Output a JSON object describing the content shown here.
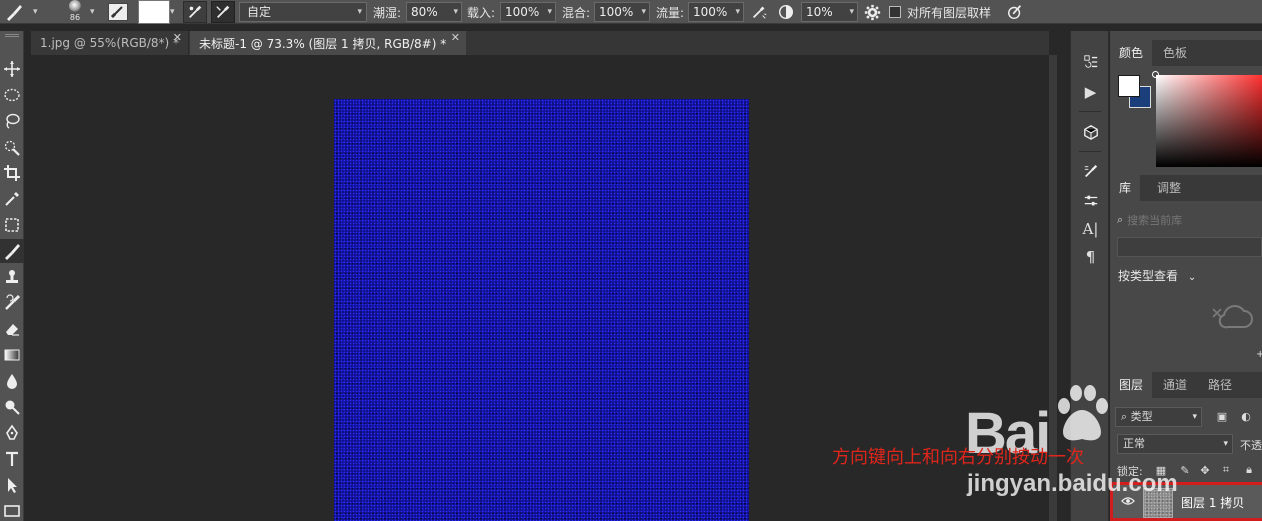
{
  "options_bar": {
    "brush_size": "86",
    "mode_label": "自定",
    "opacity_label": "潮湿:",
    "opacity_value": "80%",
    "load_label": "载入:",
    "load_value": "100%",
    "mix_label": "混合:",
    "mix_value": "100%",
    "flow_label": "流量:",
    "flow_value": "100%",
    "angle_value": "10%",
    "sample_all_label": "对所有图层取样"
  },
  "doc_tabs": [
    {
      "title": "1.jpg @ 55%(RGB/8*) *",
      "active": false
    },
    {
      "title": "未标题-1 @ 73.3% (图层 1 拷贝, RGB/8#) *",
      "active": true
    }
  ],
  "tools": [
    {
      "icon": "move-icon"
    },
    {
      "icon": "marquee-icon"
    },
    {
      "icon": "lasso-icon"
    },
    {
      "icon": "quick-select-icon"
    },
    {
      "icon": "crop-icon"
    },
    {
      "icon": "eyedropper-icon"
    },
    {
      "icon": "frame-icon"
    },
    {
      "icon": "mixer-brush-icon",
      "active": true
    },
    {
      "icon": "clone-stamp-icon"
    },
    {
      "icon": "history-brush-icon"
    },
    {
      "icon": "eraser-icon"
    },
    {
      "icon": "gradient-icon"
    },
    {
      "icon": "blur-icon"
    },
    {
      "icon": "dodge-icon"
    },
    {
      "icon": "pen-icon"
    },
    {
      "icon": "type-icon"
    },
    {
      "icon": "path-select-icon"
    },
    {
      "icon": "rectangle-icon"
    }
  ],
  "color_panel": {
    "tabs": [
      "颜色",
      "色板"
    ],
    "foreground": "#ffffff",
    "background": "#1a3f7a"
  },
  "library_panel": {
    "tabs": [
      "库",
      "调整"
    ],
    "search_placeholder": "搜索当前库",
    "view_label": "按类型查看"
  },
  "layers_panel": {
    "tabs": [
      "图层",
      "通道",
      "路径"
    ],
    "filter_label": "类型",
    "blend_mode": "正常",
    "opacity_label": "不透",
    "lock_label": "锁定:",
    "layer_name": "图层 1 拷贝"
  },
  "annotation": "方向键向上和向右分别按动一次",
  "watermark": {
    "logo": "Bai",
    "url": "jingyan.baidu.com"
  },
  "colors": {
    "canvas_blue": "#10108a",
    "highlight_red": "#d21d1d",
    "note_red": "#e0251b"
  }
}
